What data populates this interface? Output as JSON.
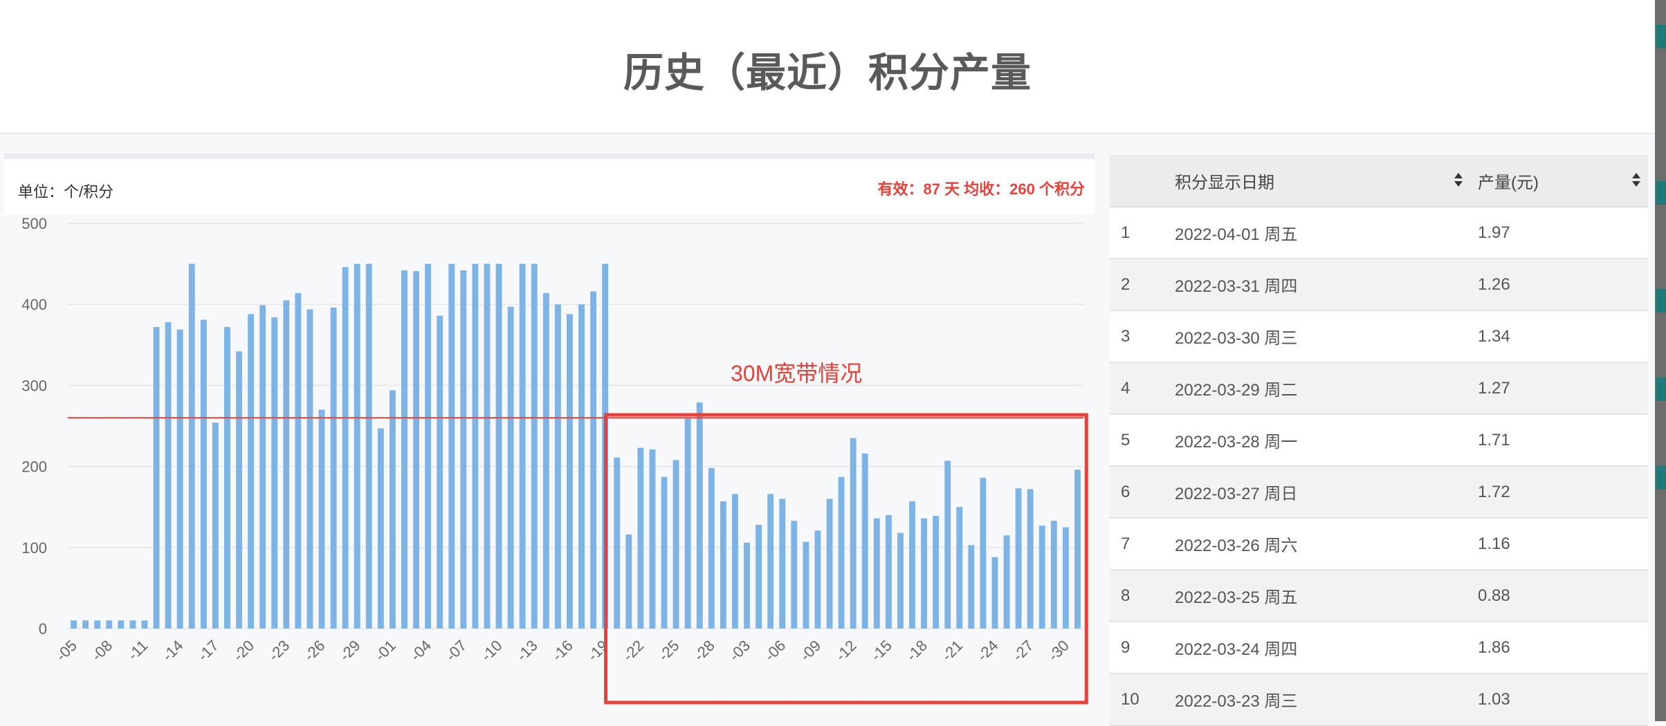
{
  "page": {
    "title": "历史（最近）积分产量"
  },
  "chart_panel": {
    "unit_text": "单位：个/积分",
    "summary_text": "有效：87 天 均收：260 个积分",
    "annotation": "30M宽带情况"
  },
  "colors": {
    "bar": "#7eb3e6",
    "average_line": "#e8413a",
    "highlight_box": "#e8413a",
    "grid": "#e4e6ea"
  },
  "chart_data": {
    "type": "bar",
    "yticks": [
      0,
      100,
      200,
      300,
      400,
      500
    ],
    "ylim": [
      0,
      500
    ],
    "average_line": 260,
    "grid": true,
    "legend": "none",
    "tick_labels": [
      "-05",
      "-08",
      "-11",
      "-14",
      "-17",
      "-20",
      "-23",
      "-26",
      "-29",
      "-01",
      "-04",
      "-07",
      "-10",
      "-13",
      "-16",
      "-19",
      "-22",
      "-25",
      "-28",
      "-03",
      "-06",
      "-09",
      "-12",
      "-15",
      "-18",
      "-21",
      "-24",
      "-27",
      "-30"
    ],
    "values": [
      10,
      10,
      10,
      10,
      10,
      10,
      10,
      372,
      378,
      369,
      450,
      381,
      254,
      372,
      342,
      388,
      399,
      384,
      405,
      414,
      394,
      270,
      396,
      446,
      450,
      450,
      247,
      294,
      442,
      441,
      450,
      386,
      450,
      442,
      450,
      450,
      450,
      397,
      450,
      450,
      414,
      400,
      388,
      400,
      416,
      450,
      211,
      116,
      223,
      221,
      187,
      208,
      260,
      279,
      198,
      157,
      166,
      106,
      128,
      166,
      160,
      133,
      107,
      121,
      160,
      187,
      235,
      216,
      136,
      140,
      118,
      157,
      136,
      139,
      207,
      150,
      103,
      186,
      88,
      115,
      173,
      172,
      127,
      133,
      125,
      196
    ],
    "highlight_range": {
      "start_index": 46,
      "end_index": 85
    }
  },
  "table": {
    "headers": {
      "date": "积分显示日期",
      "value": "产量(元)"
    },
    "rows": [
      {
        "idx": "1",
        "date": "2022-04-01 周五",
        "value": "1.97"
      },
      {
        "idx": "2",
        "date": "2022-03-31 周四",
        "value": "1.26"
      },
      {
        "idx": "3",
        "date": "2022-03-30 周三",
        "value": "1.34"
      },
      {
        "idx": "4",
        "date": "2022-03-29 周二",
        "value": "1.27"
      },
      {
        "idx": "5",
        "date": "2022-03-28 周一",
        "value": "1.71"
      },
      {
        "idx": "6",
        "date": "2022-03-27 周日",
        "value": "1.72"
      },
      {
        "idx": "7",
        "date": "2022-03-26 周六",
        "value": "1.16"
      },
      {
        "idx": "8",
        "date": "2022-03-25 周五",
        "value": "0.88"
      },
      {
        "idx": "9",
        "date": "2022-03-24 周四",
        "value": "1.86"
      },
      {
        "idx": "10",
        "date": "2022-03-23 周三",
        "value": "1.03"
      }
    ]
  }
}
